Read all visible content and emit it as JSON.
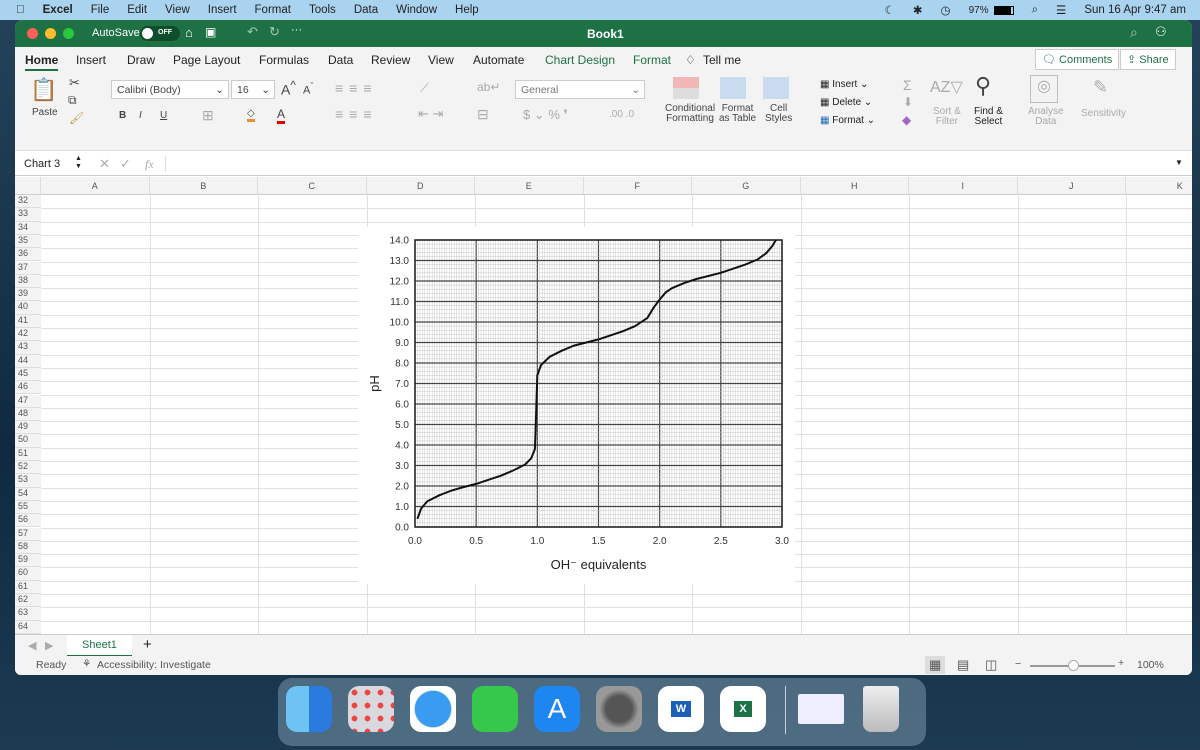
{
  "menubar": {
    "app": "Excel",
    "items": [
      "File",
      "Edit",
      "View",
      "Insert",
      "Format",
      "Tools",
      "Data",
      "Window",
      "Help"
    ],
    "battery": "97%",
    "datetime": "Sun 16 Apr  9:47 am"
  },
  "titlebar": {
    "autosave": "AutoSave",
    "autosave_state": "OFF",
    "title": "Book1"
  },
  "tabs": [
    "Home",
    "Insert",
    "Draw",
    "Page Layout",
    "Formulas",
    "Data",
    "Review",
    "View",
    "Automate",
    "Chart Design",
    "Format"
  ],
  "tell_me": "Tell me",
  "comments": "Comments",
  "share": "Share",
  "ribbon": {
    "paste": "Paste",
    "font": "Calibri (Body)",
    "size": "16",
    "number_format": "General",
    "cond_fmt": [
      "Conditional",
      "Formatting"
    ],
    "fmt_table": [
      "Format",
      "as Table"
    ],
    "cell_styles": [
      "Cell",
      "Styles"
    ],
    "insert": "Insert",
    "delete": "Delete",
    "format": "Format",
    "sort": [
      "Sort &",
      "Filter"
    ],
    "find": [
      "Find &",
      "Select"
    ],
    "analyse": [
      "Analyse",
      "Data"
    ],
    "sensitivity": "Sensitivity",
    "bold": "B",
    "italic": "I",
    "underline": "U"
  },
  "formula_bar": {
    "name_box": "Chart 3",
    "fx": "fx",
    "value": ""
  },
  "columns": [
    "A",
    "B",
    "C",
    "D",
    "E",
    "F",
    "G",
    "H",
    "I",
    "J",
    "K"
  ],
  "rows": [
    32,
    33,
    34,
    35,
    36,
    37,
    38,
    39,
    40,
    41,
    42,
    43,
    44,
    45,
    46,
    47,
    48,
    49,
    50,
    51,
    52,
    53,
    54,
    55,
    56,
    57,
    58,
    59,
    60,
    61,
    62,
    63,
    64,
    65
  ],
  "sheets": {
    "active": "Sheet1",
    "add": "+"
  },
  "status": {
    "ready": "Ready",
    "accessibility": "Accessibility: Investigate",
    "zoom": "100%",
    "zoom_level": 100
  },
  "colors": {
    "excel_green": "#1e7145",
    "accent": "#217346"
  },
  "chart_data": {
    "type": "line",
    "xlabel": "OH⁻ equivalents",
    "ylabel": "pH",
    "xlim": [
      0,
      3
    ],
    "ylim": [
      0,
      14
    ],
    "grid": true,
    "legend": "none",
    "xticks": [
      "0.0",
      "0.5",
      "1.0",
      "1.5",
      "2.0",
      "2.5",
      "3.0"
    ],
    "yticks": [
      "0.0",
      "1.0",
      "2.0",
      "3.0",
      "4.0",
      "5.0",
      "6.0",
      "7.0",
      "8.0",
      "9.0",
      "10.0",
      "11.0",
      "12.0",
      "13.0",
      "14.0"
    ],
    "x": [
      0.02,
      0.05,
      0.1,
      0.2,
      0.3,
      0.4,
      0.5,
      0.6,
      0.7,
      0.8,
      0.9,
      0.95,
      0.98,
      0.99,
      1.0,
      1.03,
      1.1,
      1.2,
      1.3,
      1.5,
      1.6,
      1.7,
      1.8,
      1.9,
      1.95,
      2.0,
      2.05,
      2.1,
      2.2,
      2.3,
      2.5,
      2.6,
      2.7,
      2.8,
      2.87,
      2.92,
      2.95
    ],
    "y": [
      0.4,
      0.9,
      1.25,
      1.55,
      1.78,
      1.95,
      2.1,
      2.3,
      2.5,
      2.75,
      3.05,
      3.35,
      3.8,
      5.5,
      7.4,
      7.9,
      8.3,
      8.6,
      8.85,
      9.15,
      9.35,
      9.55,
      9.8,
      10.2,
      10.7,
      11.1,
      11.45,
      11.65,
      11.9,
      12.1,
      12.4,
      12.6,
      12.8,
      13.05,
      13.35,
      13.7,
      14.0
    ]
  }
}
